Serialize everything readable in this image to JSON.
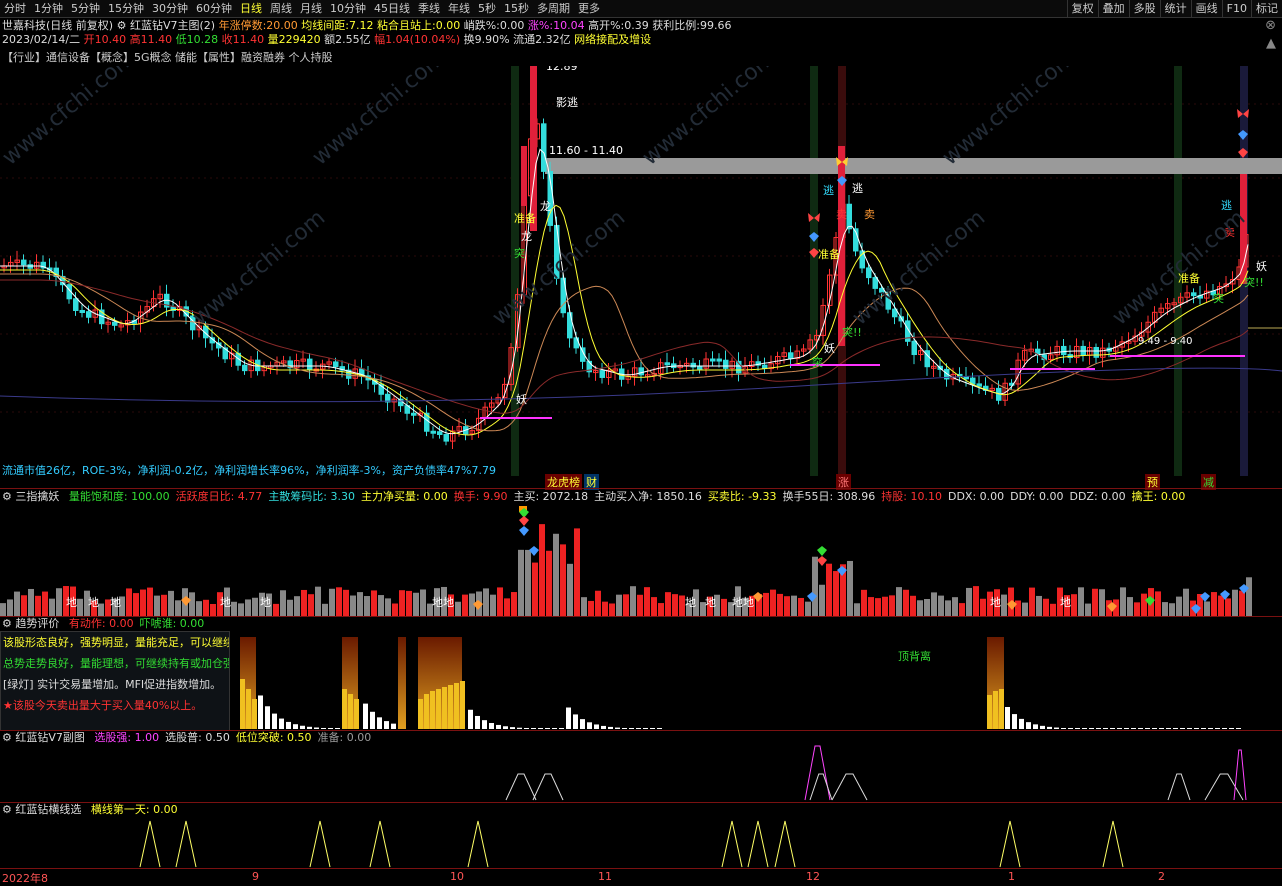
{
  "topbar": {
    "periods": [
      "分时",
      "1分钟",
      "5分钟",
      "15分钟",
      "30分钟",
      "60分钟",
      "日线",
      "周线",
      "月线",
      "10分钟",
      "45日线",
      "季线",
      "年线",
      "5秒",
      "15秒",
      "多周期",
      "更多"
    ],
    "active": "日线",
    "right_buttons": [
      "复权",
      "叠加",
      "多股",
      "统计",
      "画线",
      "F10",
      "标记"
    ]
  },
  "header": {
    "stock": "世嘉科技(日线 前复权)",
    "indicator": "红蓝钻V7主图(2)",
    "limit_label": "年涨停数:",
    "limit_value": "20.00",
    "ma_gap_label": "均线间距:",
    "ma_gap_value": "7.12",
    "stick_label": "粘合且站上:",
    "stick_value": "0.00",
    "drop_label": "峭跌%:",
    "drop_value": "0.00",
    "rise_label": "涨%:",
    "rise_value": "10.04",
    "highopen_label": "高开%:",
    "highopen_value": "0.39",
    "profit_label": "获利比例:",
    "profit_value": "99.66"
  },
  "quote": {
    "date": "2023/02/14/二",
    "open": "开10.40",
    "high": "高11.40",
    "low": "低10.28",
    "close": "收11.40",
    "volume": "量229420",
    "amount": "额2.55亿",
    "change": "幅1.04(10.04%)",
    "turnover": "换9.90%",
    "float": "流通2.32亿",
    "concept_tag": "网络接配及增设"
  },
  "tags_line": "【行业】通信设备【概念】5G概念 储能【属性】融资融券 个人持股",
  "fundamentals": "流通市值26亿，ROE-3%，净利润-0.2亿，净利润增长率96%，净利润率-3%，资产负债率47%7.79",
  "price_annotations": {
    "top_price": "12.89",
    "band_label": "11.60 - 11.40",
    "escape": "逃",
    "sell": "卖",
    "prepare": "准备",
    "dragon": "龙",
    "breakout": "突!!",
    "breakout2": "突",
    "demon": "妖",
    "ready": "准备",
    "break_label": "9.49 - 9.40",
    "shadow": "影逃",
    "bottom_marks": [
      "龙虎榜",
      "财",
      "涨",
      "预",
      "减"
    ]
  },
  "pane2": {
    "name": "三指擒妖",
    "items": [
      {
        "label": "量能饱和度:",
        "value": "100.00",
        "color": "#33dd33"
      },
      {
        "label": "活跃度日比:",
        "value": "4.77",
        "color": "#ff3333"
      },
      {
        "label": "主散筹码比:",
        "value": "3.30",
        "color": "#33dddd"
      },
      {
        "label": "主力净买量:",
        "value": "0.00",
        "color": "#ffff33"
      },
      {
        "label": "换手:",
        "value": "9.90",
        "color": "#ff3333"
      },
      {
        "label": "主买:",
        "value": "2072.18",
        "color": "#dddddd"
      },
      {
        "label": "主动买入净:",
        "value": "1850.16",
        "color": "#dddddd"
      },
      {
        "label": "买卖比:",
        "value": "-9.33",
        "color": "#ffff33"
      },
      {
        "label": "换手55日:",
        "value": "308.96",
        "color": "#dddddd"
      },
      {
        "label": "持股:",
        "value": "10.10",
        "color": "#ff3333"
      },
      {
        "label": "DDX:",
        "value": "0.00",
        "color": "#dddddd"
      },
      {
        "label": "DDY:",
        "value": "0.00",
        "color": "#dddddd"
      },
      {
        "label": "DDZ:",
        "value": "0.00",
        "color": "#dddddd"
      },
      {
        "label": "擒王:",
        "value": "0.00",
        "color": "#ffff33"
      }
    ],
    "ground_label": "地",
    "ground_label2": "地地"
  },
  "pane3": {
    "name": "趋势评价",
    "items": [
      {
        "label": "有动作:",
        "value": "0.00",
        "color": "#ff3333"
      },
      {
        "label": "吓唬谁:",
        "value": "0.00",
        "color": "#33dd33"
      }
    ],
    "box_lines": [
      {
        "text": "该股形态良好，强势明显，量能充足，可以继续持有。",
        "color": "#ffff33"
      },
      {
        "text": "总势走势良好，量能理想，可继续持有或加仓强势股。",
        "color": "#33dd33"
      },
      {
        "text": "[绿灯] 实计交易量增加。MFI促进指数增加。",
        "color": "#dddddd"
      },
      {
        "text": "★该股今天卖出量大于买入量40%以上。",
        "color": "#ff3333"
      }
    ],
    "divergence": "顶背离"
  },
  "pane4": {
    "name": "红蓝钻V7副图",
    "items": [
      {
        "label": "选股强:",
        "value": "1.00",
        "color": "#ff44ff"
      },
      {
        "label": "选股普:",
        "value": "0.50",
        "color": "#dddddd"
      },
      {
        "label": "低位突破:",
        "value": "0.50",
        "color": "#ffff33"
      },
      {
        "label": "准备:",
        "value": "0.00",
        "color": "#999999"
      }
    ]
  },
  "pane5": {
    "name": "红蓝钻横线选",
    "items": [
      {
        "label": "横线第一天:",
        "value": "0.00",
        "color": "#ffff33"
      }
    ]
  },
  "date_axis": [
    "2022年8",
    "9",
    "10",
    "11",
    "12",
    "1",
    "2"
  ],
  "watermark": "www.cfchi.com",
  "colors": {
    "up": "#ff3333",
    "down": "#33dddd",
    "ma5": "#ffffff",
    "ma10": "#ffff33",
    "ma20": "#ff66ff",
    "ma60": "#33dd33",
    "grid": "#7a1111",
    "band": "#9a9a9a"
  }
}
